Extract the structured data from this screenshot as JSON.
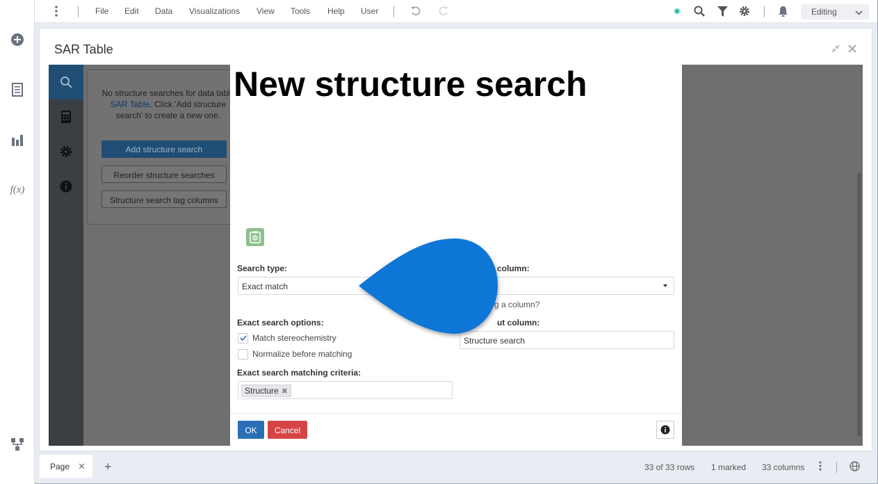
{
  "menubar": {
    "items": [
      "File",
      "Edit",
      "Data",
      "Visualizations",
      "View",
      "Tools",
      "Help",
      "User"
    ],
    "mode": "Editing"
  },
  "panel": {
    "title": "SAR Table"
  },
  "sidepanel": {
    "message_before": "No structure searches for data table ",
    "message_link": "SAR Table",
    "message_after": ". Click 'Add structure search' to create a new one.",
    "add_button": "Add structure search",
    "reorder_button": "Reorder structure searches",
    "tag_columns_button": "Structure search tag columns"
  },
  "dialog": {
    "title": "New structure search",
    "search_type_label": "Search type:",
    "search_type_value": "Exact match",
    "structure_column_label": "column:",
    "structure_column_value": "",
    "missing_column_hint": "g a column?",
    "exact_options_label": "Exact search options:",
    "option_stereo": "Match stereochemistry",
    "option_stereo_checked": true,
    "option_normalize": "Normalize before matching",
    "option_normalize_checked": false,
    "output_column_label": "ut column:",
    "output_column_value": "Structure search",
    "criteria_label": "Exact search matching criteria:",
    "criteria_tag": "Structure",
    "ok": "OK",
    "cancel": "Cancel"
  },
  "statusbar": {
    "page_tab": "Page",
    "rows": "33 of 33 rows",
    "marked": "1 marked",
    "columns": "33 columns"
  },
  "colors": {
    "accent": "#2a6fb5",
    "danger": "#d64545",
    "blob": "#0b76d6",
    "clipboard": "#8fc08f"
  }
}
